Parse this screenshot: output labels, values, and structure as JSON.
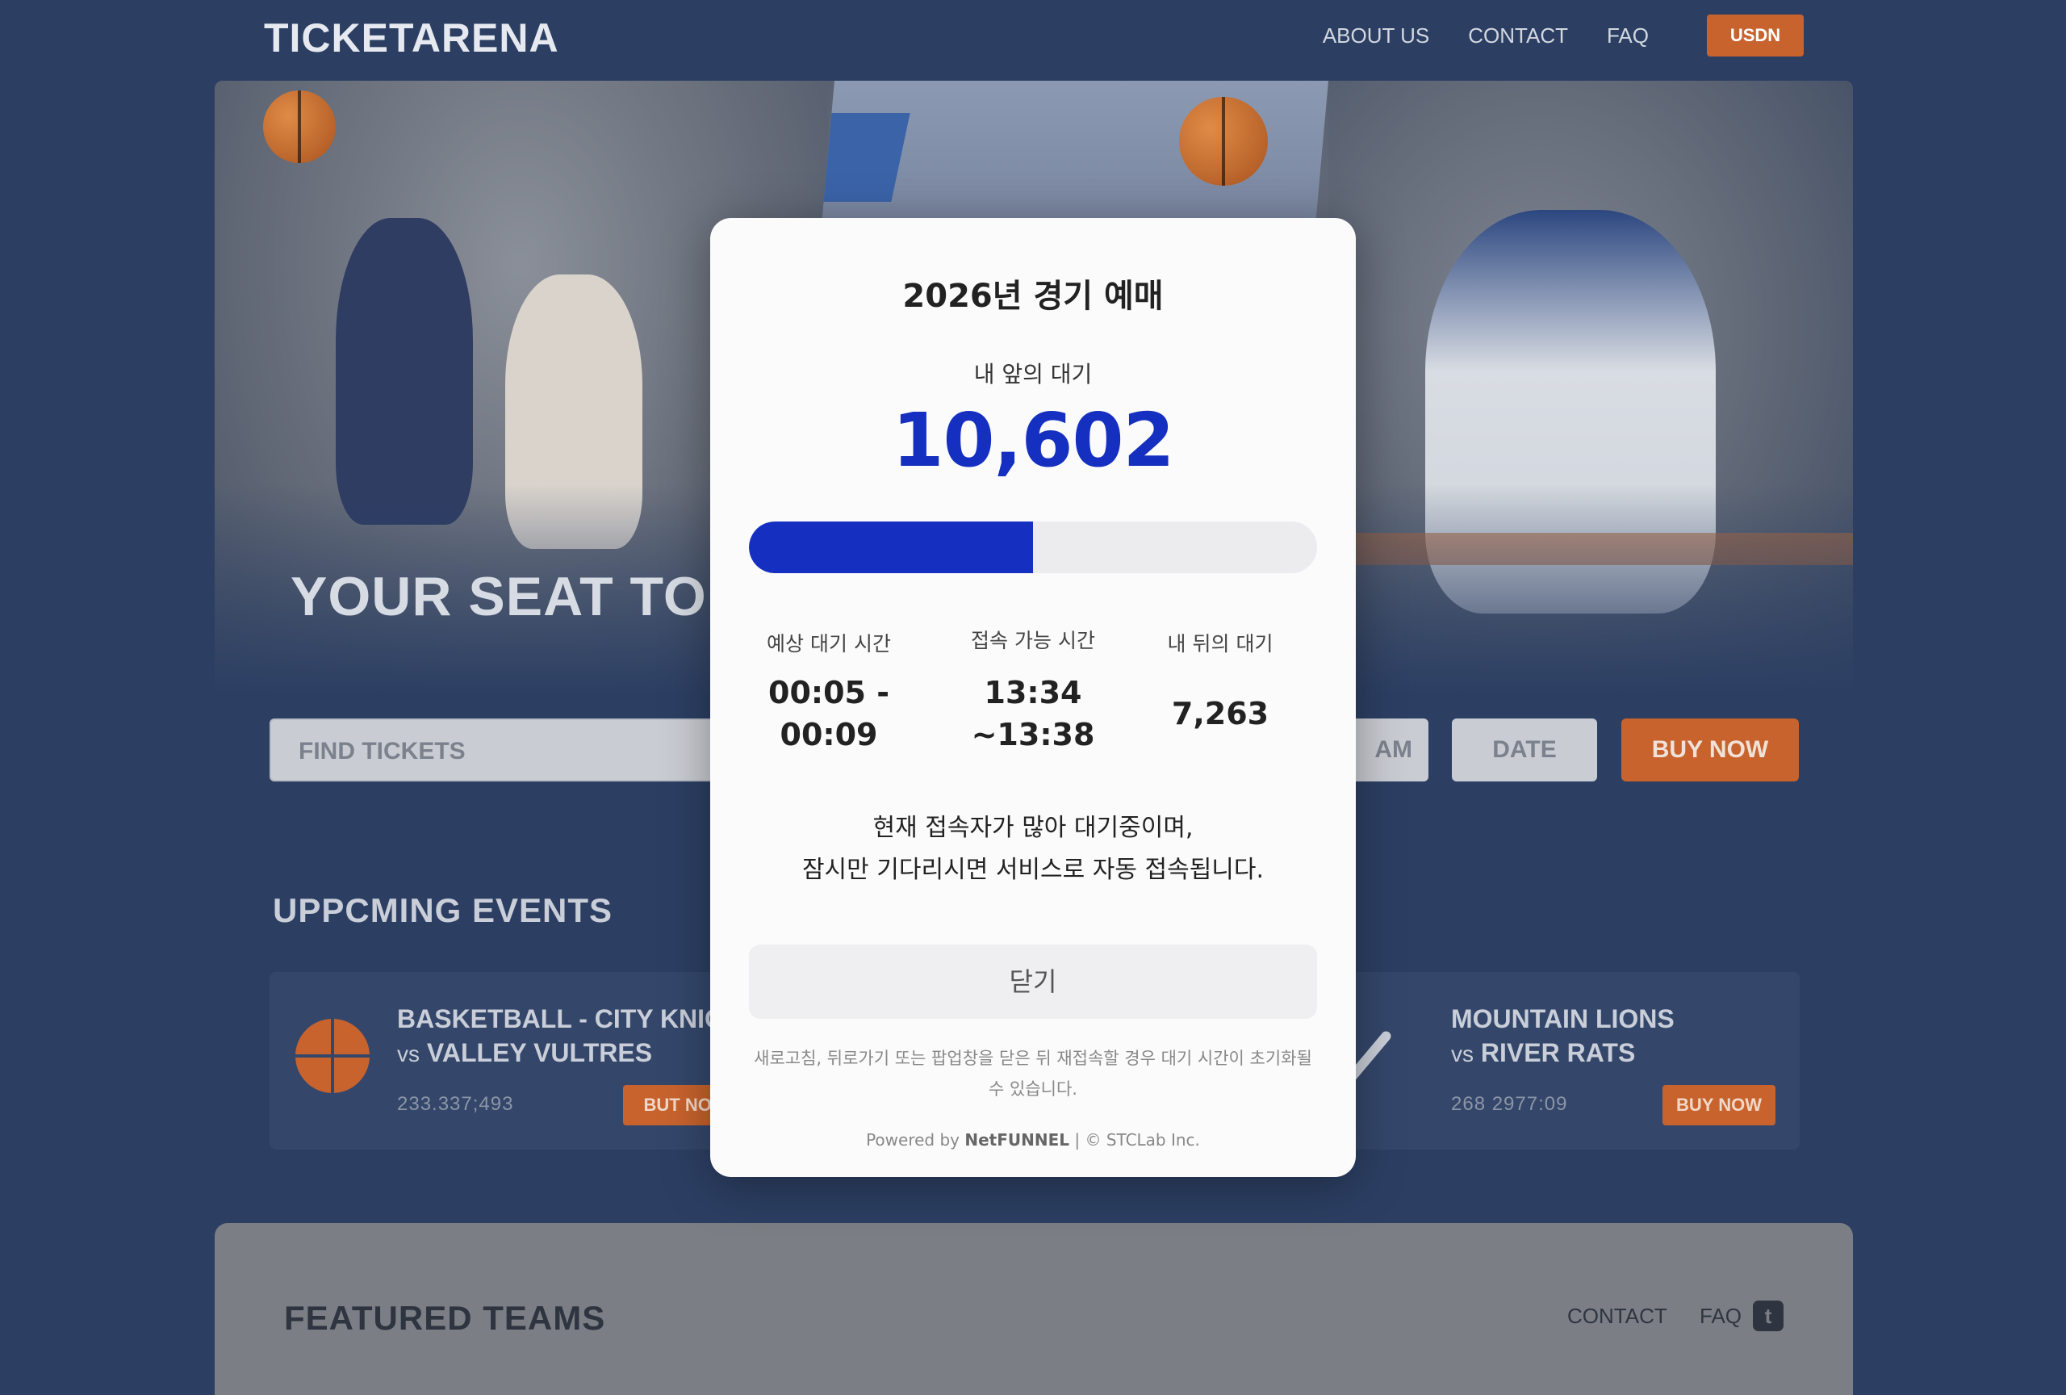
{
  "header": {
    "brand": "TICKETARENA",
    "nav": [
      "ABOUT US",
      "CONTACT",
      "FAQ"
    ],
    "cta": "USDN"
  },
  "hero": {
    "title": "YOUR SEAT TO T"
  },
  "search": {
    "placeholder": "FIND TICKETS",
    "team_fragment": "AM",
    "date_label": "DATE",
    "buy_label": "BUY NOW"
  },
  "events": {
    "section_title": "UPPCMING EVENTS",
    "items": [
      {
        "line1": "BASKETBALL - CITY KNIG",
        "line2": "VALLEY VULTRES",
        "vs": "vs",
        "date": "233.337;493",
        "button": "BUT NOV"
      },
      {
        "line1": "MOUNTAIN LIONS",
        "line2": "RIVER RATS",
        "vs": "vs",
        "date": "268 2977:09",
        "button": "BUY NOW"
      }
    ]
  },
  "featured": {
    "title": "FEATURED TEAMS",
    "links": [
      "CONTACT",
      "FAQ"
    ],
    "social_icon": "twitter-icon"
  },
  "modal": {
    "title": "2026년 경기 예매",
    "ahead_label": "내 앞의 대기",
    "ahead_count": "10,602",
    "progress": 0.5,
    "stats": [
      {
        "label": "예상 대기 시간",
        "value_line1": "00:05 -",
        "value_line2": "00:09"
      },
      {
        "label": "접속 가능 시간",
        "value_line1": "13:34",
        "value_line2": "~13:38"
      },
      {
        "label": "내 뒤의 대기",
        "value_line1": "7,263",
        "value_line2": ""
      }
    ],
    "message_line1": "현재 접속자가 많아 대기중이며,",
    "message_line2": "잠시만 기다리시면 서비스로 자동 접속됩니다.",
    "close_label": "닫기",
    "note": "새로고침, 뒤로가기 또는 팝업창을 닫은 뒤 재접속할 경우 대기 시간이 초기화될 수 있습니다.",
    "powered_prefix": "Powered by ",
    "powered_brand": "NetFUNNEL",
    "powered_suffix": " | © STCLab Inc."
  },
  "colors": {
    "accent": "#1530c0",
    "brand_orange": "#c8632e",
    "background": "#2c3f63"
  }
}
